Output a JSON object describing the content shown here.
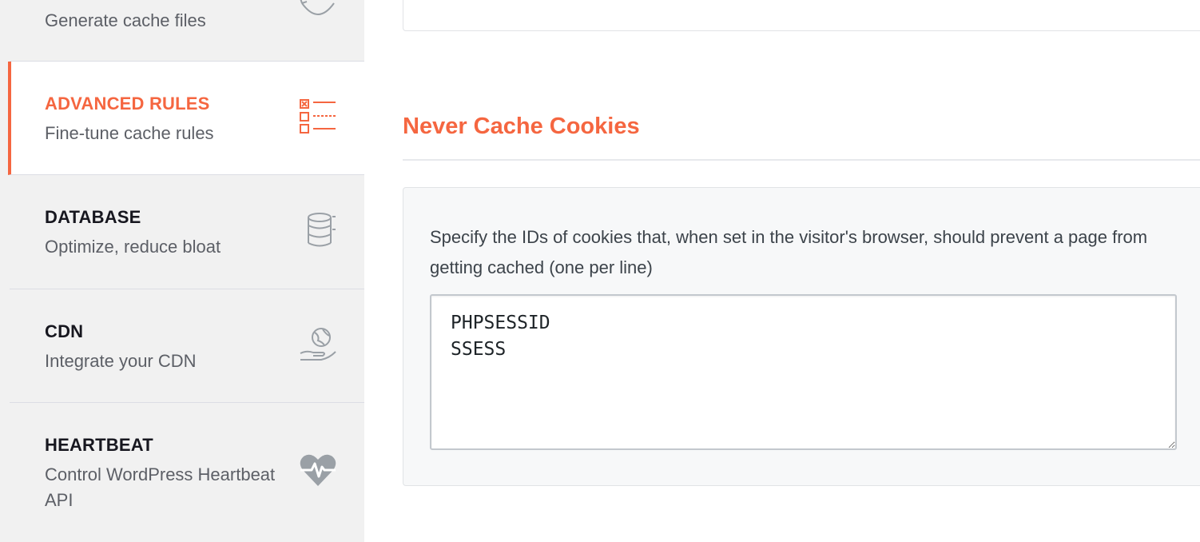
{
  "sidebar": {
    "items": [
      {
        "title": "",
        "sub": "Generate cache files",
        "icon": "refresh-icon"
      },
      {
        "title": "ADVANCED RULES",
        "sub": "Fine-tune cache rules",
        "icon": "checklist-icon",
        "active": true
      },
      {
        "title": "DATABASE",
        "sub": "Optimize, reduce bloat",
        "icon": "database-icon"
      },
      {
        "title": "CDN",
        "sub": "Integrate your CDN",
        "icon": "globe-hand-icon"
      },
      {
        "title": "HEARTBEAT",
        "sub": "Control WordPress Heartbeat API",
        "icon": "heartbeat-icon"
      }
    ]
  },
  "main": {
    "section_title": "Never Cache Cookies",
    "field_description": "Specify the IDs of cookies that, when set in the visitor's browser, should prevent a page from getting cached (one per line)",
    "cookie_ids_value": "PHPSESSID\nSSESS"
  },
  "colors": {
    "accent": "#f56640",
    "sidebar_bg": "#f1f1f1"
  }
}
